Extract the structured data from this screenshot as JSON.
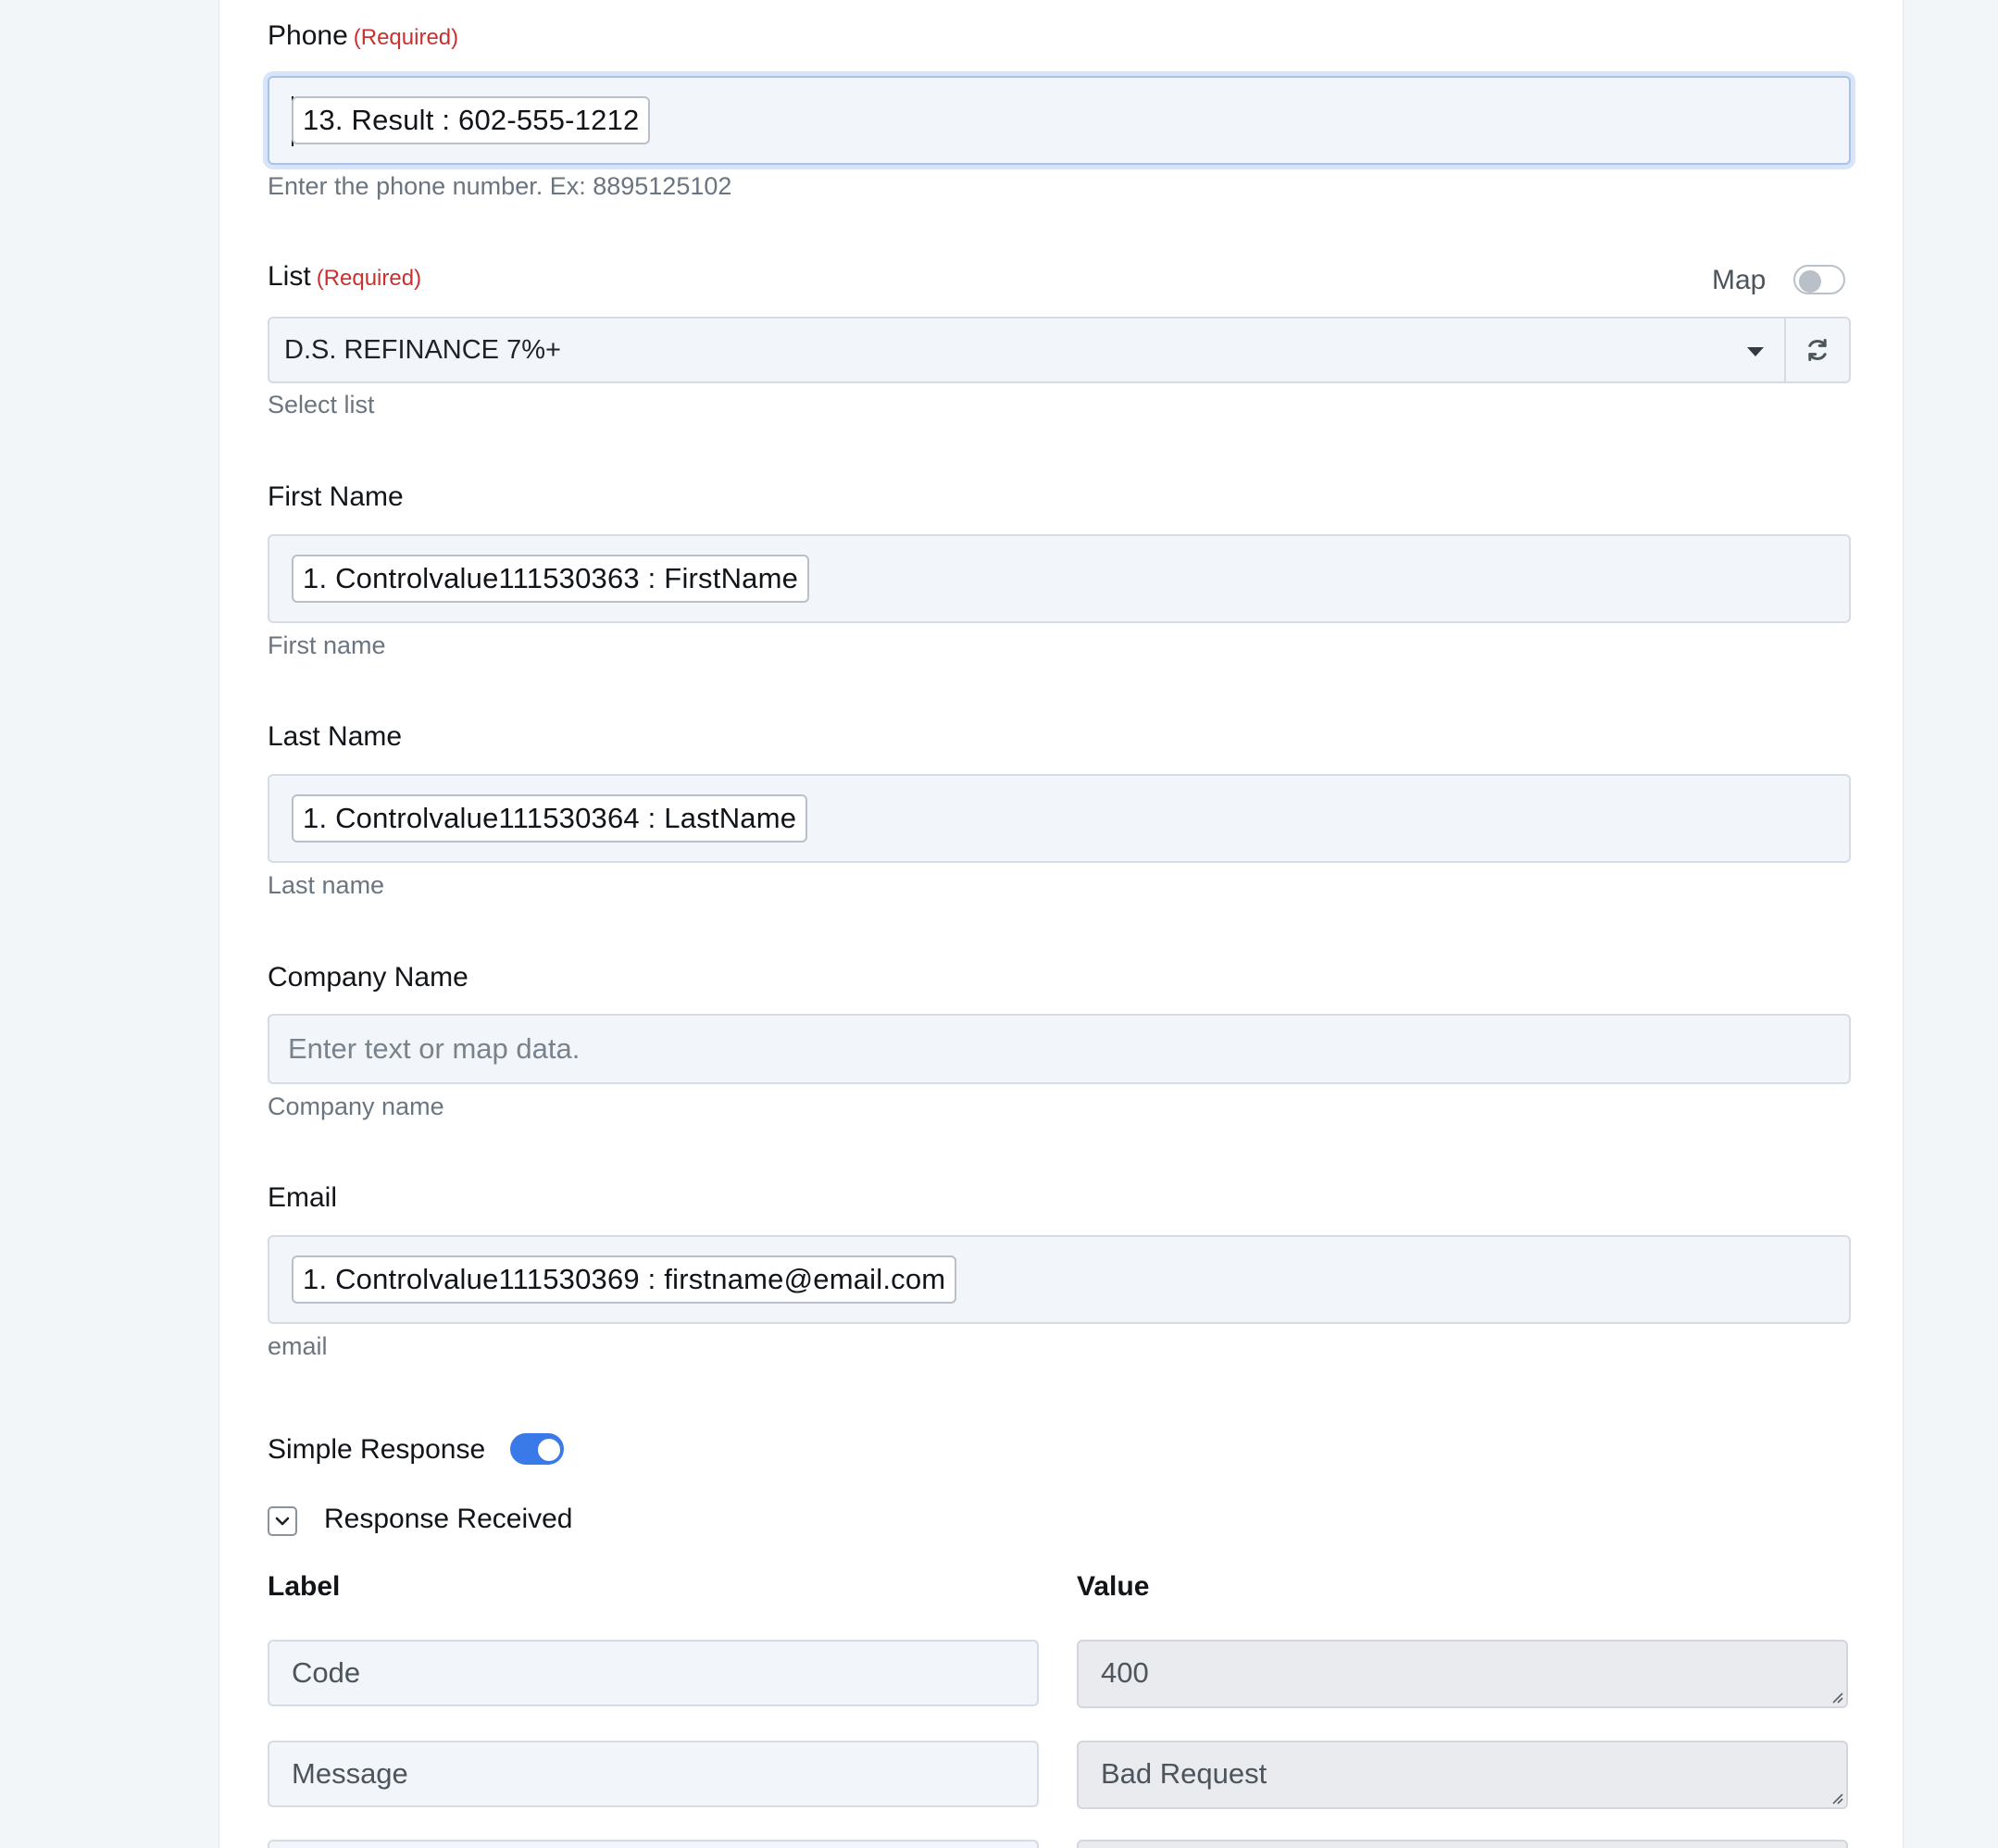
{
  "phone": {
    "label": "Phone",
    "required": "(Required)",
    "chip": "13. Result : 602-555-1212",
    "help": "Enter the phone number. Ex: 8895125102"
  },
  "list": {
    "label": "List",
    "required": "(Required)",
    "map_label": "Map",
    "map_toggle_on": false,
    "selected": "D.S. REFINANCE 7%+",
    "help": "Select list"
  },
  "first_name": {
    "label": "First Name",
    "chip": "1. Controlvalue111530363 : FirstName",
    "help": "First name"
  },
  "last_name": {
    "label": "Last Name",
    "chip": "1. Controlvalue111530364 : LastName",
    "help": "Last name"
  },
  "company_name": {
    "label": "Company Name",
    "placeholder": "Enter text or map data.",
    "help": "Company name"
  },
  "email": {
    "label": "Email",
    "chip": "1. Controlvalue111530369 : firstname@email.com",
    "help": "email"
  },
  "simple_response": {
    "label": "Simple Response",
    "toggle_on": true
  },
  "response_received": {
    "title": "Response Received",
    "label_header": "Label",
    "value_header": "Value",
    "rows": [
      {
        "label": "Code",
        "value": "400"
      },
      {
        "label": "Message",
        "value": "Bad Request"
      }
    ]
  },
  "colors": {
    "required": "#c8312f",
    "toggle_on": "#3a7ae8",
    "focus_ring": "#a9c2ec"
  }
}
